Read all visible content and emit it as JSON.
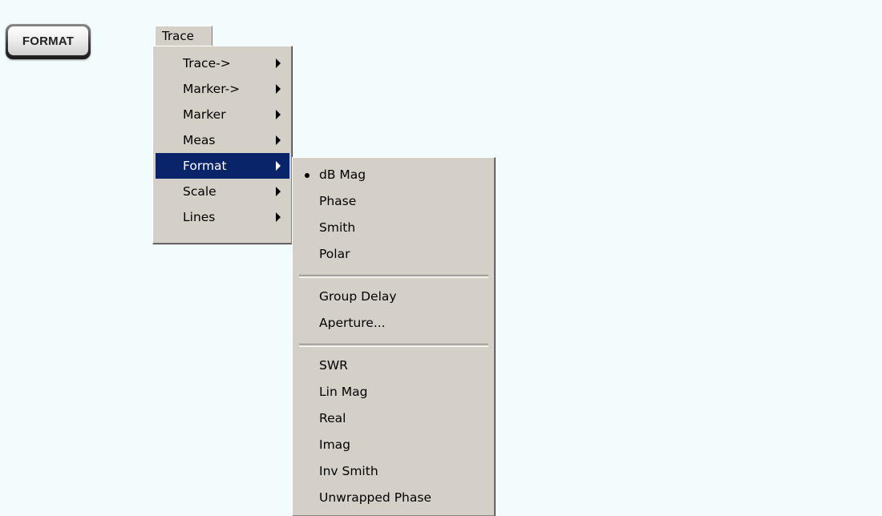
{
  "hardkey": {
    "label": "FORMAT"
  },
  "menubar": {
    "trace_label": "Trace"
  },
  "trace_menu": {
    "items": [
      {
        "label": "Trace->",
        "has_submenu": true
      },
      {
        "label": "Marker->",
        "has_submenu": true
      },
      {
        "label": "Marker",
        "has_submenu": true
      },
      {
        "label": "Meas",
        "has_submenu": true
      },
      {
        "label": "Format",
        "has_submenu": true,
        "highlighted": true
      },
      {
        "label": "Scale",
        "has_submenu": true
      },
      {
        "label": "Lines",
        "has_submenu": true
      }
    ]
  },
  "format_menu": {
    "groups": [
      [
        {
          "label": "dB Mag",
          "selected": true
        },
        {
          "label": "Phase"
        },
        {
          "label": "Smith"
        },
        {
          "label": "Polar"
        }
      ],
      [
        {
          "label": "Group Delay"
        },
        {
          "label": "Aperture..."
        }
      ],
      [
        {
          "label": "SWR"
        },
        {
          "label": "Lin Mag"
        },
        {
          "label": "Real"
        },
        {
          "label": "Imag"
        },
        {
          "label": "Inv Smith"
        },
        {
          "label": "Unwrapped Phase"
        }
      ]
    ]
  },
  "colors": {
    "menu_background": "#d4d0c8",
    "highlight": "#0a246a",
    "page_tint": "#f2fcfc"
  }
}
